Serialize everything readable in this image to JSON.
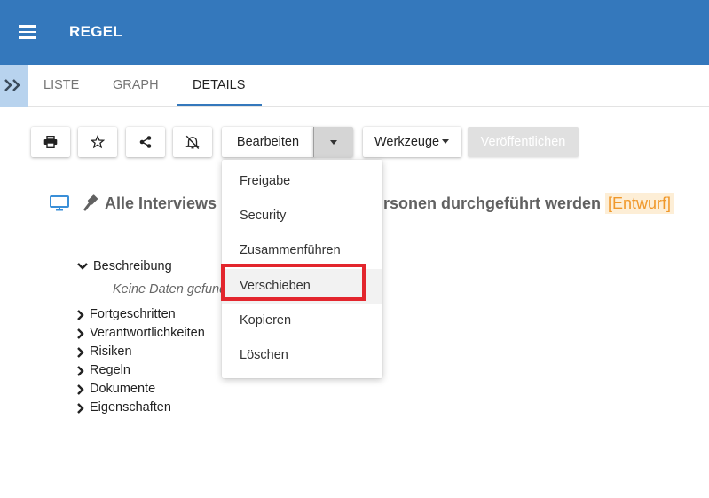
{
  "appbar": {
    "title": "REGEL",
    "color": "#3478bc",
    "menu_icon": "hamburger-icon"
  },
  "tabs": [
    {
      "label": "LISTE",
      "active": false
    },
    {
      "label": "GRAPH",
      "active": false
    },
    {
      "label": "DETAILS",
      "active": true
    }
  ],
  "toolbar": {
    "print_icon": "print-icon",
    "favorite_icon": "star-icon",
    "share_icon": "share-icon",
    "notifications_icon": "bell-off-icon",
    "edit_label": "Bearbeiten",
    "tools_label": "Werkzeuge",
    "publish_label": "Veröffentlichen"
  },
  "edit_menu": {
    "items": [
      "Freigabe",
      "Security",
      "Zusammenführen",
      "Verschieben",
      "Kopieren",
      "Löschen"
    ],
    "highlighted": "Verschieben",
    "highlight_color": "#e3262d"
  },
  "document": {
    "title_visible_left": "Alle Interviews",
    "title_visible_right": "rsonen durchgeführt werden",
    "status": "[Entwurf]",
    "status_color": "#f0982a",
    "type_icon": "monitor-icon",
    "rule_icon": "gavel-icon"
  },
  "tree": {
    "expanded": {
      "label": "Beschreibung",
      "empty_text": "Keine Daten gefund"
    },
    "collapsed": [
      "Fortgeschritten",
      "Verantwortlichkeiten",
      "Risiken",
      "Regeln",
      "Dokumente",
      "Eigenschaften"
    ]
  }
}
